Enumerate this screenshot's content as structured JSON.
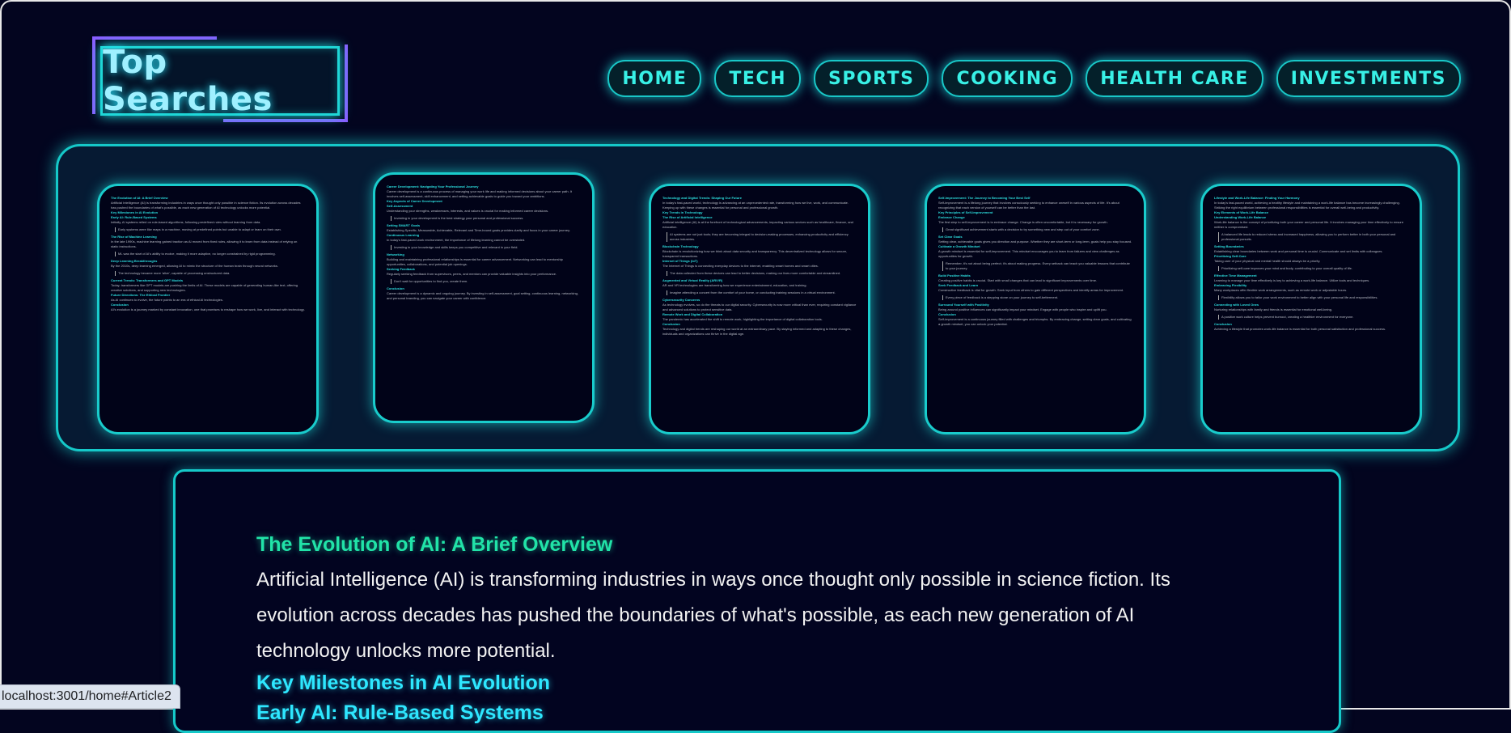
{
  "logo": {
    "text": "Top Searches"
  },
  "nav": {
    "items": [
      "HOME",
      "TECH",
      "SPORTS",
      "COOKING",
      "HEALTH CARE",
      "INVESTMENTS"
    ]
  },
  "cards": [
    {
      "title": "The Evolution of AI: A Brief Overview",
      "blocks": [
        {
          "t": "p",
          "text": "Artificial Intelligence (AI) is transforming industries in ways once thought only possible in science fiction. Its evolution across decades has pushed the boundaries of what's possible, as each new generation of AI technology unlocks more potential."
        },
        {
          "t": "h",
          "text": "Key Milestones in AI Evolution"
        },
        {
          "t": "h",
          "text": "Early AI: Rule-Based Systems"
        },
        {
          "t": "p",
          "text": "Initially, AI systems relied on rule-based algorithms, following predefined rules without learning from data."
        },
        {
          "t": "q",
          "text": "Early systems were like maps in a machine, moving at predefined points but unable to adapt or learn on their own."
        },
        {
          "t": "h",
          "text": "The Rise of Machine Learning"
        },
        {
          "t": "p",
          "text": "In the late 1990s, machine learning gained traction as AI moved from fixed rules, allowing it to learn from data instead of relying on static instructions."
        },
        {
          "t": "q",
          "text": "ML was the start of AI's ability to evolve, making it more adaptive, no longer constrained by rigid programming."
        },
        {
          "t": "h",
          "text": "Deep Learning Breakthroughs"
        },
        {
          "t": "p",
          "text": "By the 2010s, deep learning emerged, allowing AI to mimic the structure of the human brain through neural networks."
        },
        {
          "t": "q",
          "text": "The technology became more 'alive', capable of processing unstructured data."
        },
        {
          "t": "h",
          "text": "Current Trends: Transformers and GPT Models"
        },
        {
          "t": "p",
          "text": "Today, transformers like GPT models are pushing the limits of AI. These models are capable of generating human-like text, offering creative solutions, and supporting new technologies."
        },
        {
          "t": "h",
          "text": "Future Directions: The Ethical Frontier"
        },
        {
          "t": "p",
          "text": "As AI continues to evolve, the future points to an era of ethical AI technologies."
        },
        {
          "t": "h",
          "text": "Conclusion"
        },
        {
          "t": "p",
          "text": "AI's evolution is a journey marked by constant innovation, one that promises to reshape how we work, live, and interact with technology."
        }
      ]
    },
    {
      "title": "Career Development: Navigating Your Professional Journey",
      "blocks": [
        {
          "t": "p",
          "text": "Career development is a continuous process of managing your work life and making informed decisions about your career path. It involves self-assessment, skill enhancement, and setting achievable goals to guide you toward your ambitions."
        },
        {
          "t": "h",
          "text": "Key Aspects of Career Development"
        },
        {
          "t": "h",
          "text": "Self-Assessment"
        },
        {
          "t": "p",
          "text": "Understanding your strengths, weaknesses, interests, and values is crucial for making informed career decisions."
        },
        {
          "t": "q",
          "text": "Investing in your development is the best strategy your personal and professional success."
        },
        {
          "t": "h",
          "text": "Setting SMART Goals"
        },
        {
          "t": "p",
          "text": "Establishing Specific, Measurable, Achievable, Relevant and Time-bound goals provides clarity and focus in your career journey."
        },
        {
          "t": "h",
          "text": "Continuous Learning"
        },
        {
          "t": "p",
          "text": "In today's fast-paced work environment, the importance of lifelong learning cannot be overstated."
        },
        {
          "t": "q",
          "text": "Investing in your knowledge and skills keeps you competitive and relevant in your field."
        },
        {
          "t": "h",
          "text": "Networking"
        },
        {
          "t": "p",
          "text": "Building and maintaining professional relationships is essential for career advancement. Networking can lead to mentorship opportunities, collaborations, and potential job openings."
        },
        {
          "t": "h",
          "text": "Seeking Feedback"
        },
        {
          "t": "p",
          "text": "Regularly seeking feedback from supervisors, peers, and mentors can provide valuable insights into your performance."
        },
        {
          "t": "q",
          "text": "Don't wait for opportunities to find you, create them."
        },
        {
          "t": "h",
          "text": "Conclusion"
        },
        {
          "t": "p",
          "text": "Career development is a dynamic and ongoing journey. By investing in self-assessment, goal setting, continuous learning, networking, and personal branding, you can navigate your career with confidence."
        }
      ]
    },
    {
      "title": "Technology and Digital Trends: Shaping Our Future",
      "blocks": [
        {
          "t": "p",
          "text": "In today's fast-paced world, technology is advancing at an unprecedented rate, transforming how we live, work, and communicate. Keeping up with these changes is essential for personal and professional growth."
        },
        {
          "t": "h",
          "text": "Key Trends in Technology"
        },
        {
          "t": "h",
          "text": "The Rise of Artificial Intelligence"
        },
        {
          "t": "p",
          "text": "Artificial intelligence (AI) is at the forefront of technological advancements, impacting various sectors such as healthcare, finance, and education."
        },
        {
          "t": "q",
          "text": "AI systems are not just tools; they are becoming integral to decision-making processes, enhancing productivity and efficiency across industries."
        },
        {
          "t": "h",
          "text": "Blockchain Technology"
        },
        {
          "t": "p",
          "text": "Blockchain is revolutionizing how we think about data security and transparency. This decentralized technology allows for secure, transparent transactions."
        },
        {
          "t": "h",
          "text": "Internet of Things (IoT)"
        },
        {
          "t": "p",
          "text": "The Internet of Things is connecting everyday devices to the internet, enabling smart homes and smart cities."
        },
        {
          "t": "q",
          "text": "The data collected from these devices can lead to better decisions, making our lives more comfortable and streamlined."
        },
        {
          "t": "h",
          "text": "Augmented and Virtual Reality (AR/VR)"
        },
        {
          "t": "p",
          "text": "AR and VR technologies are transforming how we experience entertainment, education, and training."
        },
        {
          "t": "q",
          "text": "Imagine attending a concert from the comfort of your home, or conducting training sessions in a virtual environment."
        },
        {
          "t": "h",
          "text": "Cybersecurity Concerns"
        },
        {
          "t": "p",
          "text": "As technology evolves, so do the threats to our digital security. Cybersecurity is now more critical than ever, requiring constant vigilance and advanced solutions to protect sensitive data."
        },
        {
          "t": "h",
          "text": "Remote Work and Digital Collaboration"
        },
        {
          "t": "p",
          "text": "The pandemic has accelerated the shift to remote work, highlighting the importance of digital collaboration tools."
        },
        {
          "t": "h",
          "text": "Conclusion"
        },
        {
          "t": "p",
          "text": "Technology and digital trends are reshaping our world at an extraordinary pace. By staying informed and adapting to these changes, individuals and organizations can thrive in the digital age."
        }
      ]
    },
    {
      "title": "Self-Improvement: The Journey to Becoming Your Best Self",
      "blocks": [
        {
          "t": "p",
          "text": "Self-improvement is a lifelong journey that involves consciously seeking to enhance oneself in various aspects of life. It's about recognizing that each version of yourself can be better than the last."
        },
        {
          "t": "h",
          "text": "Key Principles of Self-Improvement"
        },
        {
          "t": "h",
          "text": "Embrace Change"
        },
        {
          "t": "p",
          "text": "The first step to self-improvement is to embrace change. Change is often uncomfortable, but it is necessary for growth."
        },
        {
          "t": "q",
          "text": "Great significant achievement starts with a decision to try something new and step out of your comfort zone."
        },
        {
          "t": "h",
          "text": "Set Clear Goals"
        },
        {
          "t": "p",
          "text": "Setting clear, achievable goals gives you direction and purpose. Whether they are short-term or long-term, goals help you stay focused."
        },
        {
          "t": "h",
          "text": "Cultivate a Growth Mindset"
        },
        {
          "t": "p",
          "text": "A growth mindset is essential for self-improvement. This mindset encourages you to learn from failures and view challenges as opportunities for growth."
        },
        {
          "t": "q",
          "text": "Remember, it's not about being perfect; it's about making progress. Every setback can teach you valuable lessons that contribute to your journey."
        },
        {
          "t": "h",
          "text": "Build Positive Habits"
        },
        {
          "t": "p",
          "text": "Creating positive habits is crucial. Start with small changes that can lead to significant improvements over time."
        },
        {
          "t": "h",
          "text": "Seek Feedback and Learn"
        },
        {
          "t": "p",
          "text": "Constructive feedback is vital for growth. Seek input from others to gain different perspectives and identify areas for improvement."
        },
        {
          "t": "q",
          "text": "Every piece of feedback is a stepping stone on your journey to self-betterment."
        },
        {
          "t": "h",
          "text": "Surround Yourself with Positivity"
        },
        {
          "t": "p",
          "text": "Being around positive influences can significantly impact your mindset. Engage with people who inspire and uplift you."
        },
        {
          "t": "h",
          "text": "Conclusion"
        },
        {
          "t": "p",
          "text": "Self-improvement is a continuous journey filled with challenges and triumphs. By embracing change, setting clear goals, and cultivating a growth mindset, you can unlock your potential."
        }
      ]
    },
    {
      "title": "Lifestyle and Work-Life Balance: Finding Your Harmony",
      "blocks": [
        {
          "t": "p",
          "text": "In today's fast-paced world, achieving a healthy lifestyle and maintaining a work-life balance has become increasingly challenging. Striking the right equilibrium between professional responsibilities is essential for overall well-being and productivity."
        },
        {
          "t": "h",
          "text": "Key Elements of Work-Life Balance"
        },
        {
          "t": "h",
          "text": "Understanding Work-Life Balance"
        },
        {
          "t": "p",
          "text": "Work-life balance is the concept of prioritizing both your career and personal life. It involves managing your time effectively to ensure neither is compromised."
        },
        {
          "t": "q",
          "text": "A balanced life leads to reduced stress and increased happiness, allowing you to perform better in both your personal and professional pursuits."
        },
        {
          "t": "h",
          "text": "Setting Boundaries"
        },
        {
          "t": "p",
          "text": "Establishing clear boundaries between work and personal time is crucial. Communicate and set limits with colleagues."
        },
        {
          "t": "h",
          "text": "Prioritizing Self-Care"
        },
        {
          "t": "p",
          "text": "Taking care of your physical and mental health should always be a priority."
        },
        {
          "t": "q",
          "text": "Prioritizing self-care improves your mind and body, contributing to your overall quality of life."
        },
        {
          "t": "h",
          "text": "Effective Time Management"
        },
        {
          "t": "p",
          "text": "Learning to manage your time effectively is key to achieving a work-life balance. Utilize tools and techniques."
        },
        {
          "t": "h",
          "text": "Embracing Flexibility"
        },
        {
          "t": "p",
          "text": "Many workplaces offer flexible work arrangements, such as remote work or adjustable hours."
        },
        {
          "t": "q",
          "text": "Flexibility allows you to tailor your work environment to better align with your personal life and responsibilities."
        },
        {
          "t": "h",
          "text": "Connecting with Loved Ones"
        },
        {
          "t": "p",
          "text": "Nurturing relationships with family and friends is essential for emotional well-being."
        },
        {
          "t": "q",
          "text": "A positive work culture helps prevent burnout, creating a healthier environment for everyone."
        },
        {
          "t": "h",
          "text": "Conclusion"
        },
        {
          "t": "p",
          "text": "Achieving a lifestyle that promotes work-life balance is essential for both personal satisfaction and professional success."
        }
      ]
    }
  ],
  "article": {
    "title": "The Evolution of AI: A Brief Overview",
    "intro": "Artificial Intelligence (AI) is transforming industries in ways once thought only possible in science fiction. Its evolution across decades has pushed the boundaries of what's possible, as each new generation of AI technology unlocks more potential.",
    "section_heading": "Key Milestones in AI Evolution",
    "subsection_heading": "Early AI: Rule-Based Systems"
  },
  "status_bar": {
    "url": "localhost:3001/home#Article2"
  }
}
